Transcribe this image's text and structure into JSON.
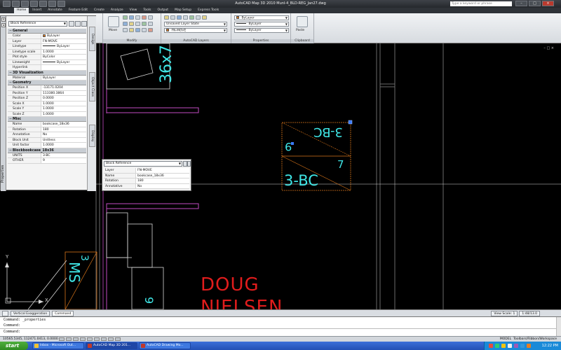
{
  "window": {
    "title": "AutoCAD Map 3D 2010    Munl-4_BLD-REG_Jan27.dwg",
    "search_placeholder": "Type a keyword or phrase"
  },
  "ribbon": {
    "tabs": [
      "Home",
      "Insert",
      "Annotate",
      "Feature Edit",
      "Create",
      "Analyze",
      "View",
      "Tools",
      "Output",
      "Map Setup",
      "Express Tools"
    ],
    "active_tab": "Home",
    "panels": {
      "modify": "Modify",
      "layers": "AutoCAD Layers",
      "properties": "Properties",
      "clipboard": "Clipboard"
    },
    "move_label": "Move",
    "layer_state": "Unsaved Layer State",
    "current_layer": "FN-MOVE",
    "color_combo": "ByLayer",
    "linetype_combo": "ByLayer",
    "lineweight_combo": "ByLayer",
    "paste_label": "Paste"
  },
  "properties_palette": {
    "selector": "Block Reference",
    "side_tabs": [
      "Design",
      "Object Class",
      "Display"
    ],
    "strip_label": "Properties",
    "sections": [
      {
        "title": "General",
        "rows": [
          {
            "k": "Color",
            "v": "ByLayer",
            "swatch": "#e07b1e"
          },
          {
            "k": "Layer",
            "v": "FN-MOVE"
          },
          {
            "k": "Linetype",
            "v": "ByLayer",
            "line": true
          },
          {
            "k": "Linetype scale",
            "v": "1.0000"
          },
          {
            "k": "Plot style",
            "v": "ByColor"
          },
          {
            "k": "Lineweight",
            "v": "ByLayer",
            "line": true
          },
          {
            "k": "Hyperlink",
            "v": ""
          }
        ]
      },
      {
        "title": "3D Visualization",
        "rows": [
          {
            "k": "Material",
            "v": "ByLayer"
          }
        ]
      },
      {
        "title": "Geometry",
        "rows": [
          {
            "k": "Position X",
            "v": "-13171.0204"
          },
          {
            "k": "Position Y",
            "v": "113380.3864"
          },
          {
            "k": "Position Z",
            "v": "0.0000"
          },
          {
            "k": "Scale X",
            "v": "1.0000"
          },
          {
            "k": "Scale Y",
            "v": "1.0000"
          },
          {
            "k": "Scale Z",
            "v": "1.0000"
          }
        ]
      },
      {
        "title": "Misc",
        "rows": [
          {
            "k": "Name",
            "v": "bookcase_18x36"
          },
          {
            "k": "Rotation",
            "v": "180"
          },
          {
            "k": "Annotative",
            "v": "No"
          },
          {
            "k": "Block Unit",
            "v": "Unitless"
          },
          {
            "k": "Unit factor",
            "v": "1.0000"
          }
        ]
      },
      {
        "title": "Blockbookcase_18x36",
        "rows": [
          {
            "k": "UNITS",
            "v": "3-BC"
          },
          {
            "k": "OTHER",
            "v": "9"
          }
        ]
      }
    ]
  },
  "quick_properties": {
    "selector": "Block Reference",
    "rows": [
      {
        "k": "Layer",
        "v": "FN-MOVE"
      },
      {
        "k": "Name",
        "v": "bookcase_18x36"
      },
      {
        "k": "Rotation",
        "v": "180"
      },
      {
        "k": "Annotative",
        "v": "No"
      }
    ]
  },
  "drawing": {
    "labels": {
      "top_room": "36x7",
      "bc_top": "3-BC",
      "bc_nine": "9",
      "bc_seven": "7",
      "bc_bottom": "3-BC",
      "ms_three": "3",
      "ms": "MS",
      "doug": "DOUG",
      "nielsen": "NIELSEN",
      "small_nine": "9"
    },
    "ucs_x": "X",
    "ucs_y": "Y",
    "colors": {
      "cyan": "#3fe6e6",
      "magenta": "#c24cc2",
      "orange": "#d9751a",
      "red": "#e01c1c",
      "white_lines": "#d8d8d8",
      "gray_lines": "#6a6a6a"
    }
  },
  "layout_tabs": {
    "tabs": [
      "Vertical Exaggeration",
      "Command"
    ],
    "view_scale": "View Scale: 1",
    "scale_value": "1:48/13.0"
  },
  "command": {
    "lines": [
      "Command: _properties",
      "Command:"
    ],
    "prompt": "Command:"
  },
  "status": {
    "coords": "10565.5345, 112471.0413, 0.0000",
    "model": "MODEL",
    "toolbar_hint": "Toolbars/Ribbon/Workspace"
  },
  "taskbar": {
    "start": "start",
    "tasks": [
      {
        "label": "Inbox - Microsoft Out...",
        "active": false
      },
      {
        "label": "AutoCAD Map 3D 201...",
        "active": true
      },
      {
        "label": "AutoCAD Drawing Mo...",
        "active": false
      }
    ],
    "clock": "12:22 PM"
  }
}
